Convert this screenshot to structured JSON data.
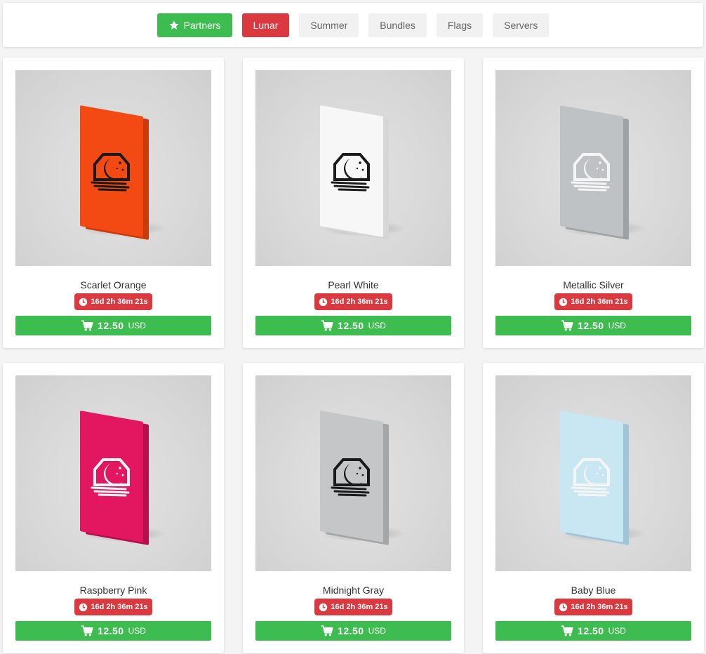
{
  "tabs": [
    {
      "label": "Partners",
      "icon": "star-icon",
      "state": "partners"
    },
    {
      "label": "Lunar",
      "state": "active"
    },
    {
      "label": "Summer",
      "state": "inactive"
    },
    {
      "label": "Bundles",
      "state": "inactive"
    },
    {
      "label": "Flags",
      "state": "inactive"
    },
    {
      "label": "Servers",
      "state": "inactive"
    }
  ],
  "colors": {
    "green": "#3dbd4f",
    "red": "#d9393f"
  },
  "products": [
    {
      "name": "Scarlet Orange",
      "timer": "16d 2h 36m 21s",
      "price": "12.50",
      "currency": "USD",
      "tile_color": "#f24a12",
      "tile_edge": "#c93a0c",
      "logo_color": "#1a1a1a"
    },
    {
      "name": "Pearl White",
      "timer": "16d 2h 36m 21s",
      "price": "12.50",
      "currency": "USD",
      "tile_color": "#f7f7f7",
      "tile_edge": "#d6d6d6",
      "logo_color": "#1a1a1a"
    },
    {
      "name": "Metallic Silver",
      "timer": "16d 2h 36m 21s",
      "price": "12.50",
      "currency": "USD",
      "tile_color": "#bfc2c4",
      "tile_edge": "#9fa2a4",
      "logo_color": "#f5f5f5"
    },
    {
      "name": "Raspberry Pink",
      "timer": "16d 2h 36m 21s",
      "price": "12.50",
      "currency": "USD",
      "tile_color": "#e3175f",
      "tile_edge": "#b5104b",
      "logo_color": "#f5f5f5"
    },
    {
      "name": "Midnight Gray",
      "timer": "16d 2h 36m 21s",
      "price": "12.50",
      "currency": "USD",
      "tile_color": "#c4c6c8",
      "tile_edge": "#a3a5a7",
      "logo_color": "#1a1a1a"
    },
    {
      "name": "Baby Blue",
      "timer": "16d 2h 36m 21s",
      "price": "12.50",
      "currency": "USD",
      "tile_color": "#c9e6f3",
      "tile_edge": "#9fc6d6",
      "logo_color": "#f5f5f5"
    }
  ]
}
